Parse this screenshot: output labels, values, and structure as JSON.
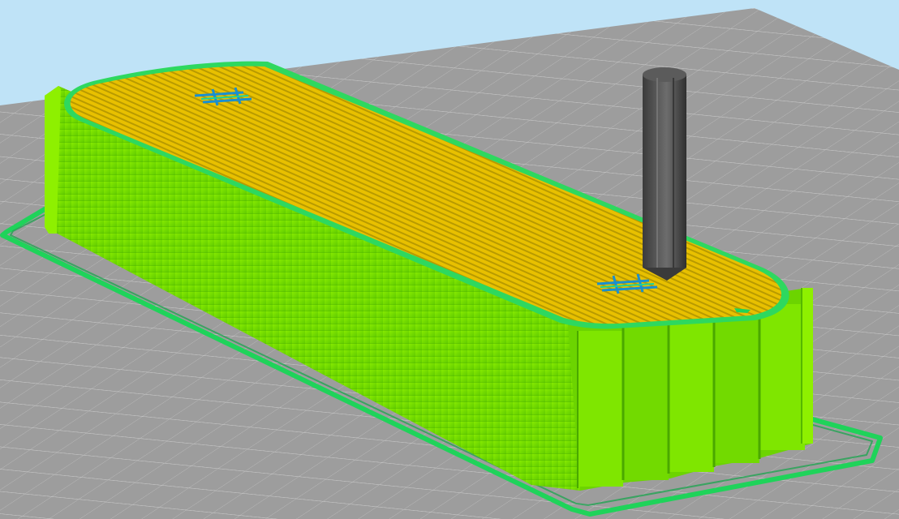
{
  "app": {
    "view": "layer preview"
  },
  "colors": {
    "background_sky": "#bfe3f7",
    "build_plate": "#9d9d9d",
    "grid_line": "#cfcfcf",
    "wall": "#7be000",
    "wall_dark": "#56b800",
    "top_infill": "#e8c000",
    "outline": "#1fd35a",
    "nozzle": "#4a4a4a",
    "nozzle_highlight": "#6a6a6a",
    "marker": "#1a8fcf"
  },
  "icons": {
    "nozzle": "nozzle-icon",
    "marker": "seam-marker-icon"
  }
}
